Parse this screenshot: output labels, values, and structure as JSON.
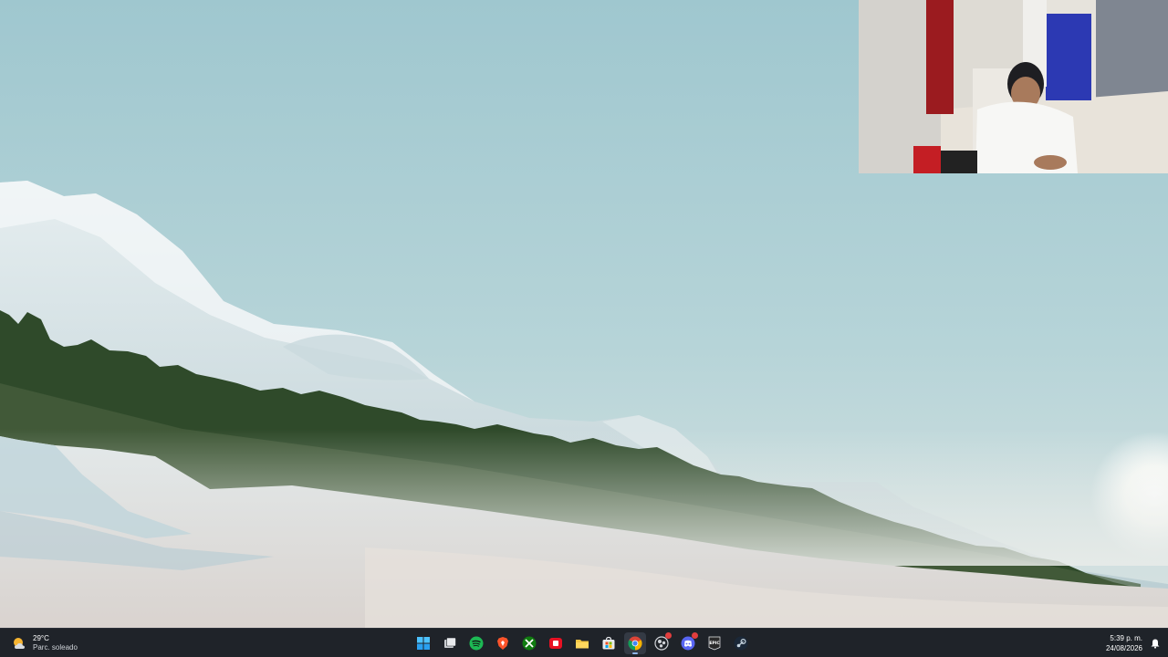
{
  "desktop": {
    "wallpaper": "snowy-mountain-forest-landscape"
  },
  "webcam": {
    "content": "person-at-desk-with-headphones"
  },
  "taskbar": {
    "weather": {
      "icon": "partly-sunny-icon",
      "temperature": "29°C",
      "condition": "Parc. soleado"
    },
    "apps": [
      {
        "name": "windows-start",
        "icon": "windows-logo-icon"
      },
      {
        "name": "task-view",
        "icon": "task-view-icon"
      },
      {
        "name": "spotify",
        "icon": "spotify-icon",
        "color": "#1db954"
      },
      {
        "name": "brave",
        "icon": "brave-icon",
        "color": "#fb542b"
      },
      {
        "name": "xbox",
        "icon": "xbox-icon",
        "color": "#107c10"
      },
      {
        "name": "red-app",
        "icon": "red-app-icon",
        "color": "#e81123"
      },
      {
        "name": "file-explorer",
        "icon": "folder-icon",
        "color": "#f4c542"
      },
      {
        "name": "store",
        "icon": "store-icon"
      },
      {
        "name": "chrome",
        "icon": "chrome-icon",
        "active": true
      },
      {
        "name": "obs",
        "icon": "obs-icon"
      },
      {
        "name": "discord",
        "icon": "discord-icon",
        "color": "#5865f2"
      },
      {
        "name": "epic-games",
        "icon": "epic-games-icon",
        "label": "EPIC"
      },
      {
        "name": "steam",
        "icon": "steam-icon"
      }
    ],
    "clock": {
      "time": "5:39 p. m.",
      "date": "24/08/2026"
    },
    "notification_icon": "notification-bell-icon"
  }
}
